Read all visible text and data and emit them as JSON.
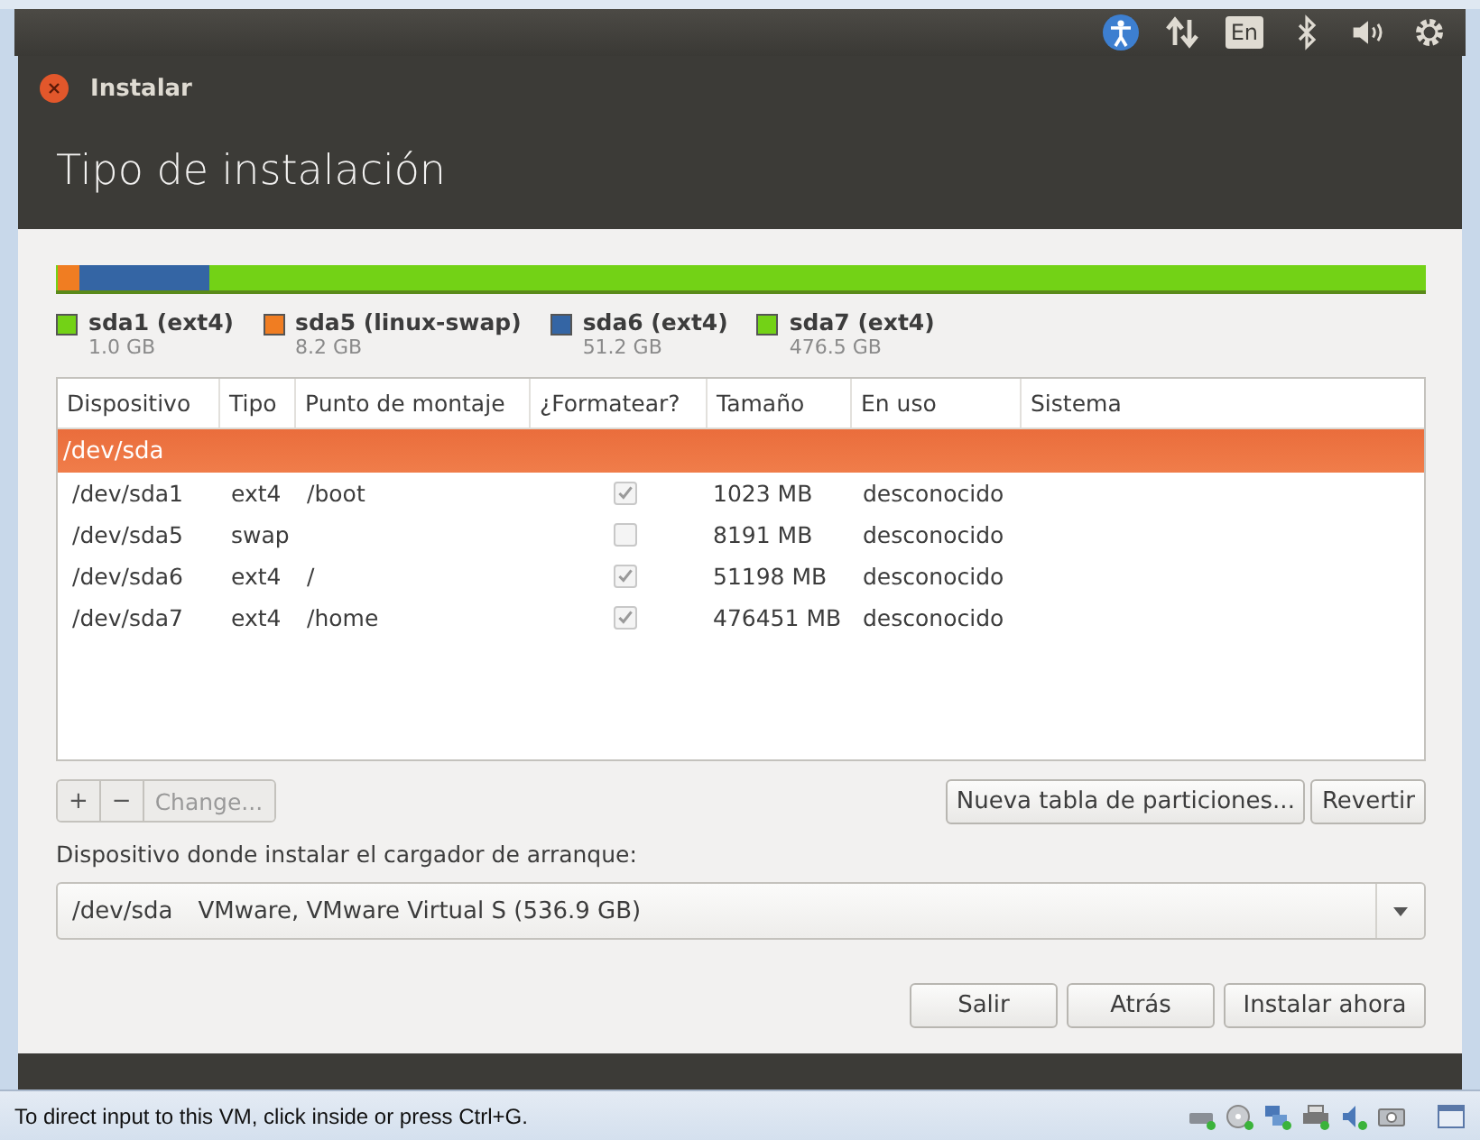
{
  "top_panel": {
    "keyboard_layout": "En"
  },
  "window": {
    "title": "Instalar",
    "heading": "Tipo de instalación"
  },
  "legend": [
    {
      "name": "sda1 (ext4)",
      "size": "1.0 GB",
      "color": "#73d216"
    },
    {
      "name": "sda5 (linux-swap)",
      "size": "8.2 GB",
      "color": "#f07d22"
    },
    {
      "name": "sda6 (ext4)",
      "size": "51.2 GB",
      "color": "#3465a4"
    },
    {
      "name": "sda7 (ext4)",
      "size": "476.5 GB",
      "color": "#73d216"
    }
  ],
  "table": {
    "columns": [
      "Dispositivo",
      "Tipo",
      "Punto de montaje",
      "¿Formatear?",
      "Tamaño",
      "En uso",
      "Sistema"
    ],
    "rows": [
      {
        "device": "/dev/sda",
        "selected": true,
        "children": [
          {
            "device": "/dev/sda1",
            "type": "ext4",
            "mount": "/boot",
            "format": true,
            "size": "1023 MB",
            "used": "desconocido",
            "selected": false
          },
          {
            "device": "/dev/sda5",
            "type": "swap",
            "format": false,
            "size": "8191 MB",
            "used": "desconocido",
            "selected": false
          },
          {
            "device": "/dev/sda6",
            "type": "ext4",
            "mount": "/",
            "format": true,
            "size": "51198 MB",
            "used": "desconocido",
            "selected": false
          },
          {
            "device": "/dev/sda7",
            "type": "ext4",
            "mount": "/home",
            "format": true,
            "size": "476451 MB",
            "used": "desconocido",
            "selected": false
          }
        ]
      }
    ]
  },
  "edit_buttons": [
    {
      "label": "+",
      "disabled": false
    },
    {
      "label": "−",
      "disabled": false
    },
    {
      "label": "Change...",
      "disabled": true
    }
  ],
  "table_buttons": [
    "Nueva tabla de particiones...",
    "Revertir"
  ],
  "bootloader": {
    "label": "Dispositivo donde instalar el cargador de arranque:",
    "device": "/dev/sda",
    "description": "VMware, VMware Virtual S (536.9 GB)"
  },
  "buttons": [
    "Salir",
    "Atrás",
    "Instalar ahora"
  ],
  "status_bar": {
    "text": "To direct input to this VM, click inside or press Ctrl+G."
  }
}
